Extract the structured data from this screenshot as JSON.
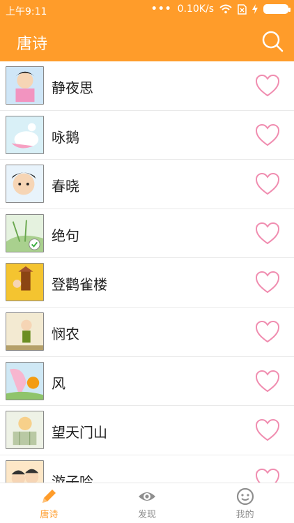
{
  "status_bar": {
    "time": "上午9:11",
    "network_speed": "0.10K/s",
    "icons": [
      "signal-dots-icon",
      "wifi-icon",
      "sim-card-icon",
      "charging-icon",
      "battery-icon"
    ]
  },
  "header": {
    "title": "唐诗",
    "search_icon": "search-icon"
  },
  "poems": [
    {
      "title": "静夜思",
      "favorite_icon": "heart-outline-icon"
    },
    {
      "title": "咏鹅",
      "favorite_icon": "heart-outline-icon"
    },
    {
      "title": "春晓",
      "favorite_icon": "heart-outline-icon"
    },
    {
      "title": "绝句",
      "favorite_icon": "heart-outline-icon"
    },
    {
      "title": "登鹳雀楼",
      "favorite_icon": "heart-outline-icon"
    },
    {
      "title": "悯农",
      "favorite_icon": "heart-outline-icon"
    },
    {
      "title": "风",
      "favorite_icon": "heart-outline-icon"
    },
    {
      "title": "望天门山",
      "favorite_icon": "heart-outline-icon"
    },
    {
      "title": "游子吟",
      "favorite_icon": "heart-outline-icon"
    }
  ],
  "bottom_nav": {
    "tabs": [
      {
        "label": "唐诗",
        "icon": "pencil-icon",
        "active": true
      },
      {
        "label": "发现",
        "icon": "eye-icon",
        "active": false
      },
      {
        "label": "我的",
        "icon": "smiley-icon",
        "active": false
      }
    ]
  },
  "colors": {
    "primary": "#ff9c2a",
    "heart": "#f08db0",
    "inactive_tab": "#8e8e8e",
    "text": "#222222"
  }
}
